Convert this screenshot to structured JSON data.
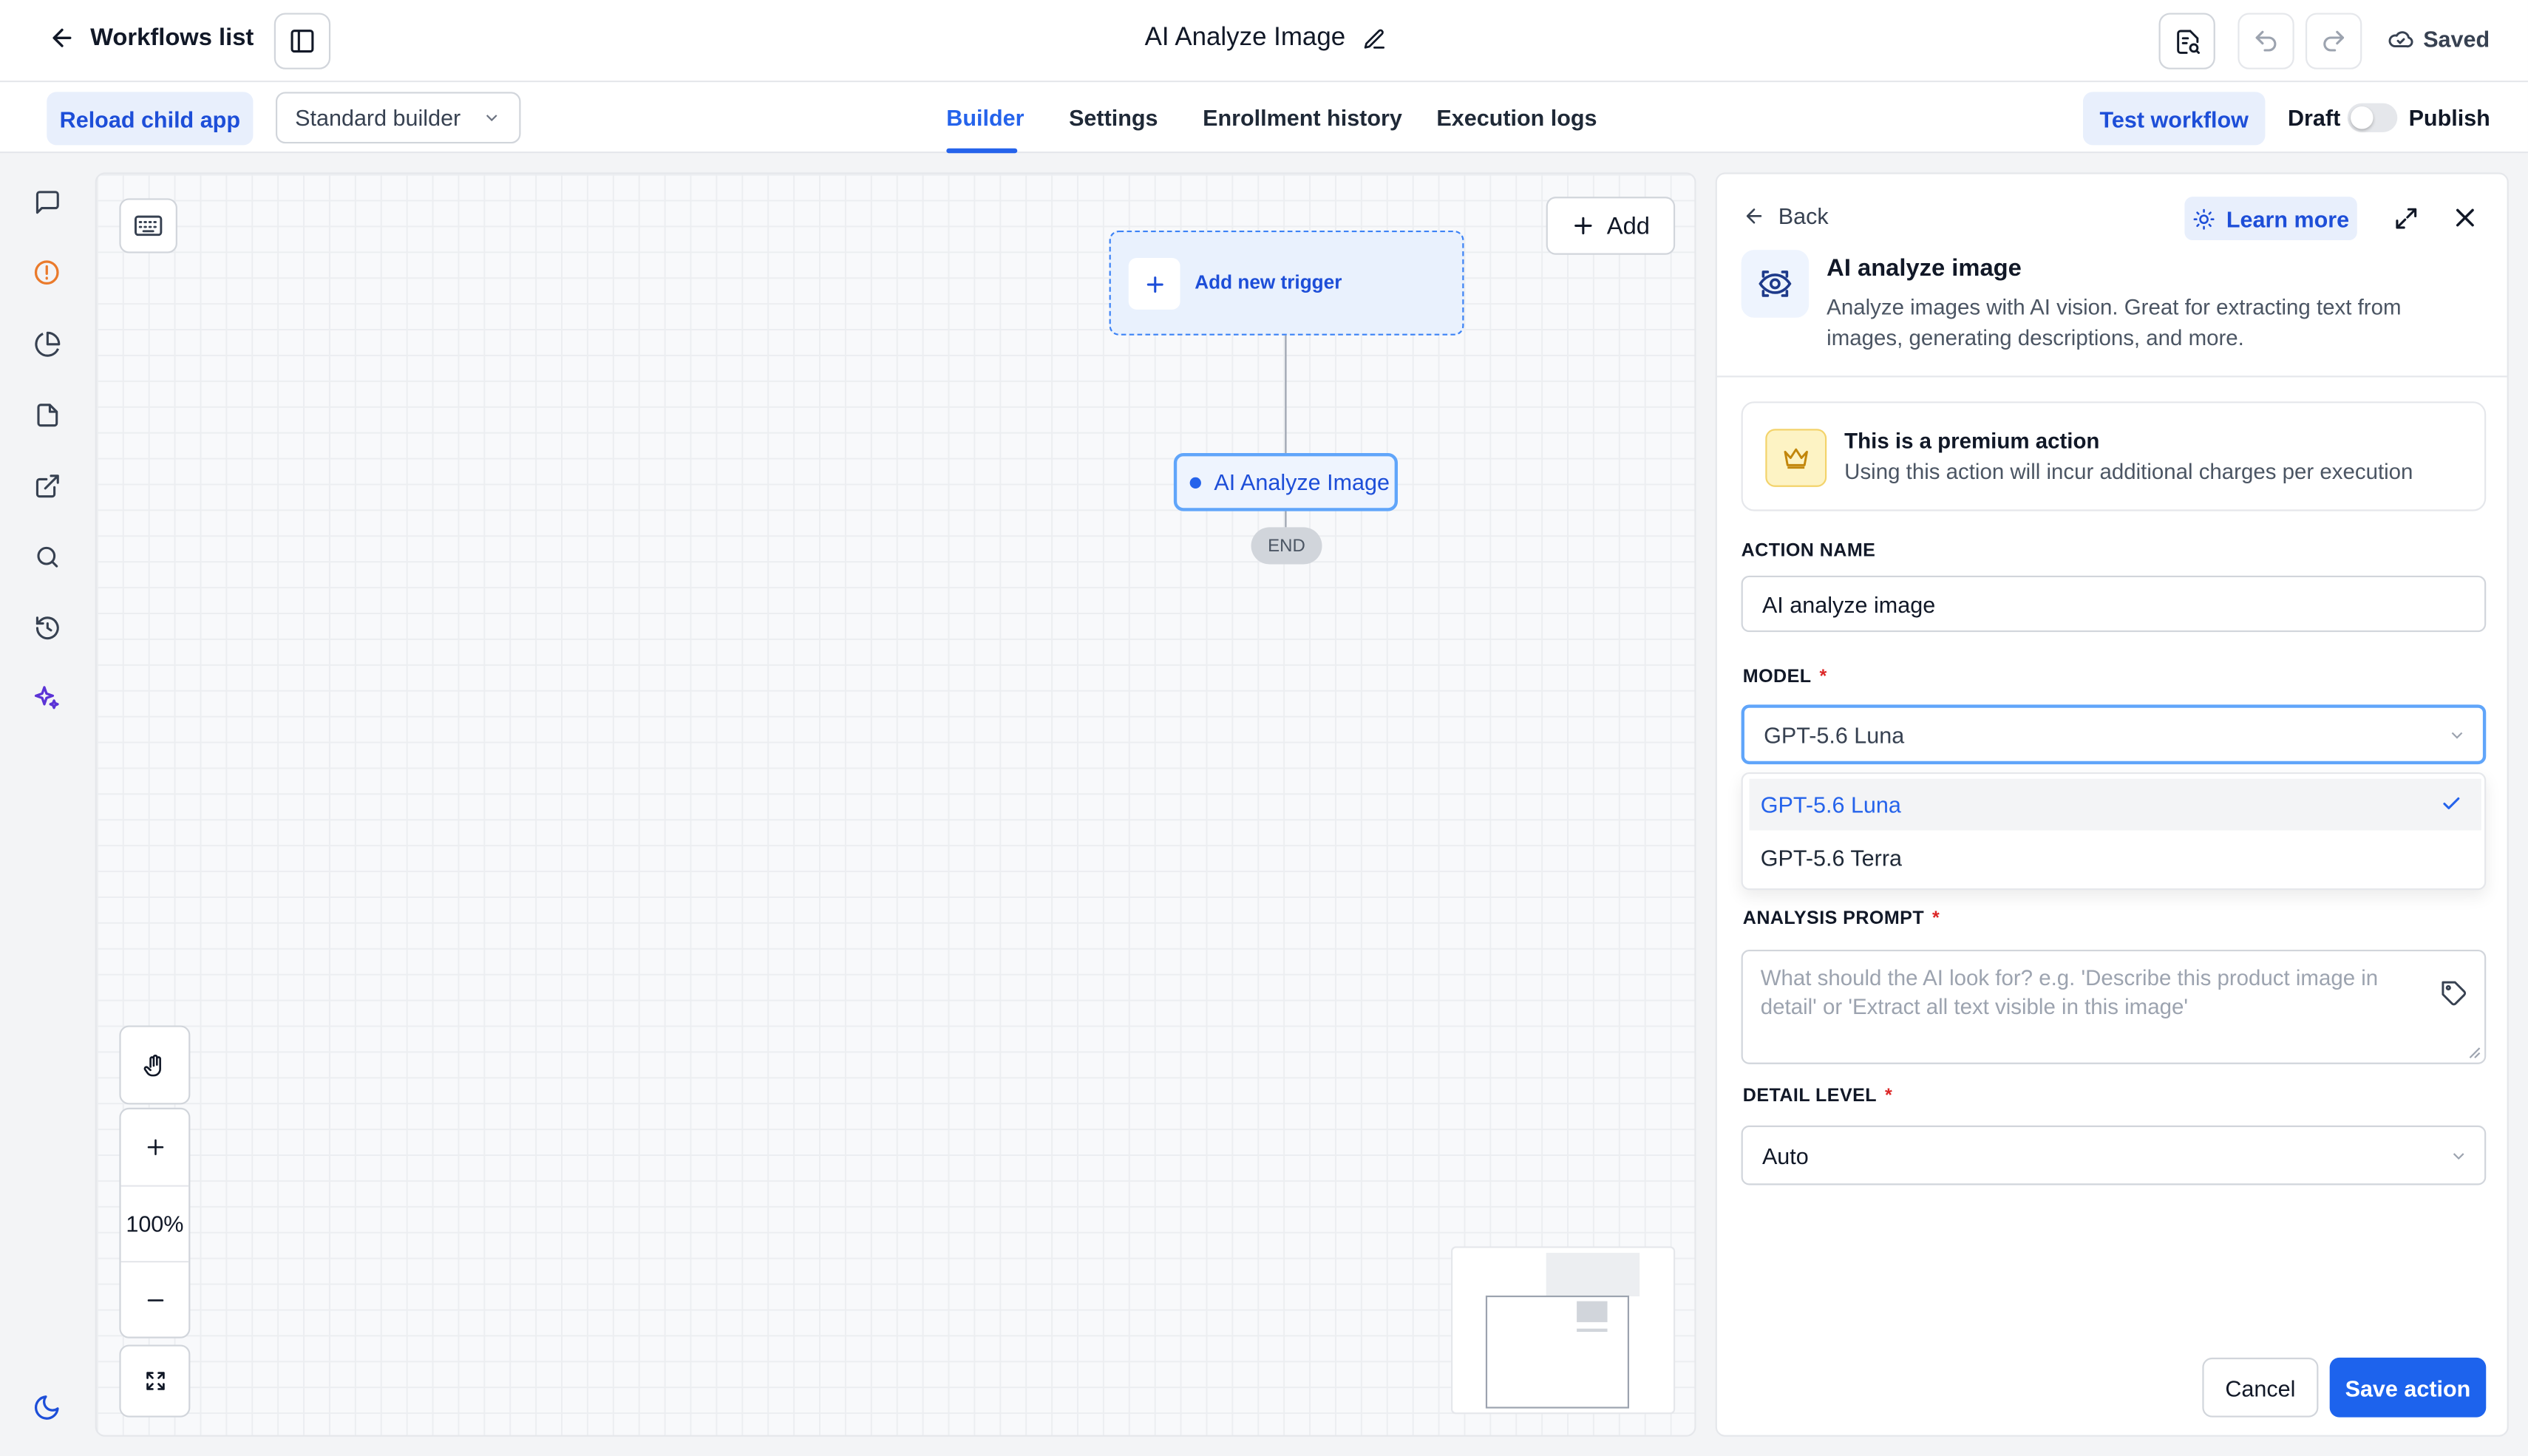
{
  "header": {
    "back_label": "Workflows list",
    "title": "AI Analyze Image",
    "saved_label": "Saved"
  },
  "subbar": {
    "reload_label": "Reload child app",
    "builder_select_value": "Standard builder",
    "tabs": [
      {
        "label": "Builder",
        "active": true
      },
      {
        "label": "Settings",
        "active": false
      },
      {
        "label": "Enrollment history",
        "active": false
      },
      {
        "label": "Execution logs",
        "active": false
      }
    ],
    "test_label": "Test workflow",
    "draft_label": "Draft",
    "publish_label": "Publish",
    "publish_enabled": false
  },
  "rail": {
    "icons": [
      "chat-icon",
      "alert-circle-icon",
      "pie-chart-icon",
      "document-icon",
      "external-link-icon",
      "search-icon",
      "history-icon",
      "sparkles-icon",
      "moon-icon"
    ]
  },
  "canvas": {
    "add_label": "Add",
    "trigger_label": "Add new trigger",
    "node_label": "AI Analyze Image",
    "end_label": "END",
    "zoom_label": "100%"
  },
  "panel": {
    "back_label": "Back",
    "learn_more_label": "Learn more",
    "title": "AI analyze image",
    "description": "Analyze images with AI vision. Great for extracting text from images, generating descriptions, and more.",
    "premium_title": "This is a premium action",
    "premium_text": "Using this action will incur additional charges per execution",
    "action_name_label": "ACTION NAME",
    "action_name_value": "AI analyze image",
    "model_label": "MODEL",
    "model_value": "GPT-5.6 Luna",
    "model_options": [
      "GPT-5.6 Luna",
      "GPT-5.6 Terra"
    ],
    "prompt_label": "ANALYSIS PROMPT",
    "prompt_placeholder": "What should the AI look for? e.g. 'Describe this product image in detail' or 'Extract all text visible in this image'",
    "detail_label": "DETAIL LEVEL",
    "detail_value": "Auto",
    "cancel_label": "Cancel",
    "save_label": "Save action"
  },
  "colors": {
    "accent": "#2563eb",
    "accent_soft": "#e8effc",
    "required": "#dc2626",
    "premium_bg": "#fdf3c4"
  }
}
